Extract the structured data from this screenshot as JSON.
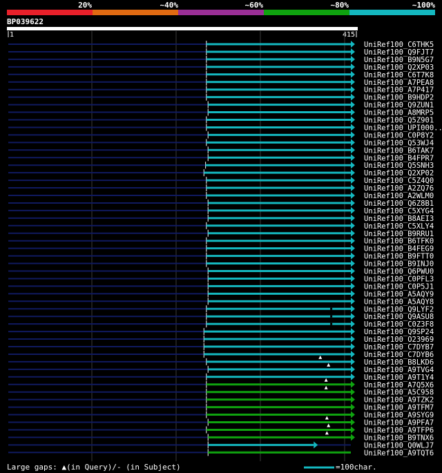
{
  "legend": {
    "labels": [
      "20%",
      "~40%",
      "~60%",
      "~80%",
      "~100%"
    ],
    "colors": [
      "#e8202a",
      "#e06a12",
      "#9a2f96",
      "#0fa30f",
      "#14b8c0"
    ]
  },
  "query": {
    "id": "BP039622",
    "start_label": "1",
    "end_label": "415",
    "length": 415
  },
  "footer": {
    "gap_text": "Large gaps: ▲(in Query)/- (in Subject)",
    "scale_text": "=100char."
  },
  "hits": [
    {
      "id": "UniRef100_C6THK5",
      "start": 240,
      "end": 415,
      "color": "cyan",
      "arrow": true
    },
    {
      "id": "UniRef100_Q9FJT7",
      "start": 240,
      "end": 415,
      "color": "cyan",
      "arrow": true
    },
    {
      "id": "UniRef100_B9N5G7",
      "start": 240,
      "end": 415,
      "color": "cyan",
      "arrow": true
    },
    {
      "id": "UniRef100_Q2XP03",
      "start": 240,
      "end": 415,
      "color": "cyan",
      "arrow": true
    },
    {
      "id": "UniRef100_C6T7K8",
      "start": 240,
      "end": 415,
      "color": "cyan",
      "arrow": true
    },
    {
      "id": "UniRef100_A7PEA8",
      "start": 240,
      "end": 415,
      "color": "cyan",
      "arrow": true
    },
    {
      "id": "UniRef100_A7P417",
      "start": 240,
      "end": 415,
      "color": "cyan",
      "arrow": true
    },
    {
      "id": "UniRef100_B9HDP2",
      "start": 240,
      "end": 415,
      "color": "cyan",
      "arrow": true
    },
    {
      "id": "UniRef100_Q9ZUN1",
      "start": 242,
      "end": 415,
      "color": "cyan",
      "arrow": true
    },
    {
      "id": "UniRef100_A8MRP5",
      "start": 242,
      "end": 415,
      "color": "cyan",
      "arrow": true
    },
    {
      "id": "UniRef100_Q5Z901",
      "start": 240,
      "end": 415,
      "color": "cyan",
      "arrow": true
    },
    {
      "id": "UniRef100_UPI000..",
      "start": 240,
      "end": 415,
      "color": "cyan",
      "arrow": true
    },
    {
      "id": "UniRef100_C0P8Y2",
      "start": 242,
      "end": 415,
      "color": "cyan",
      "arrow": true
    },
    {
      "id": "UniRef100_Q53WJ4",
      "start": 240,
      "end": 415,
      "color": "cyan",
      "arrow": true
    },
    {
      "id": "UniRef100_B6TAK7",
      "start": 242,
      "end": 415,
      "color": "cyan",
      "arrow": true
    },
    {
      "id": "UniRef100_B4FPR7",
      "start": 242,
      "end": 415,
      "color": "cyan",
      "arrow": true
    },
    {
      "id": "UniRef100_Q5SNH3",
      "start": 239,
      "end": 415,
      "color": "cyan",
      "arrow": true
    },
    {
      "id": "UniRef100_Q2XP02",
      "start": 237,
      "end": 415,
      "color": "cyan",
      "arrow": true
    },
    {
      "id": "UniRef100_C5Z4Q0",
      "start": 240,
      "end": 415,
      "color": "cyan",
      "arrow": true
    },
    {
      "id": "UniRef100_A2ZQ76",
      "start": 240,
      "end": 415,
      "color": "cyan",
      "arrow": true
    },
    {
      "id": "UniRef100_A2WLM0",
      "start": 240,
      "end": 415,
      "color": "cyan",
      "arrow": true
    },
    {
      "id": "UniRef100_Q6Z8B1",
      "start": 242,
      "end": 415,
      "color": "cyan",
      "arrow": true
    },
    {
      "id": "UniRef100_C5XYG4",
      "start": 242,
      "end": 415,
      "color": "cyan",
      "arrow": true
    },
    {
      "id": "UniRef100_B8AEI3",
      "start": 242,
      "end": 415,
      "color": "cyan",
      "arrow": true
    },
    {
      "id": "UniRef100_C5XLY4",
      "start": 240,
      "end": 415,
      "color": "cyan",
      "arrow": true
    },
    {
      "id": "UniRef100_B9RRU1",
      "start": 242,
      "end": 415,
      "color": "cyan",
      "arrow": true
    },
    {
      "id": "UniRef100_B6TFK0",
      "start": 240,
      "end": 415,
      "color": "cyan",
      "arrow": true
    },
    {
      "id": "UniRef100_B4FEG9",
      "start": 240,
      "end": 415,
      "color": "cyan",
      "arrow": true
    },
    {
      "id": "UniRef100_B9FTT0",
      "start": 240,
      "end": 415,
      "color": "cyan",
      "arrow": true
    },
    {
      "id": "UniRef100_B9INJ0",
      "start": 240,
      "end": 415,
      "color": "cyan",
      "arrow": true
    },
    {
      "id": "UniRef100_Q6PWU0",
      "start": 242,
      "end": 415,
      "color": "cyan",
      "arrow": true
    },
    {
      "id": "UniRef100_C0PFL3",
      "start": 242,
      "end": 415,
      "color": "cyan",
      "arrow": true
    },
    {
      "id": "UniRef100_C0P5J1",
      "start": 242,
      "end": 415,
      "color": "cyan",
      "arrow": true
    },
    {
      "id": "UniRef100_A5AQY9",
      "start": 242,
      "end": 415,
      "color": "cyan",
      "arrow": true
    },
    {
      "id": "UniRef100_A5AQY8",
      "start": 242,
      "end": 415,
      "color": "cyan",
      "arrow": true
    },
    {
      "id": "UniRef100_Q9LYF2",
      "start": 240,
      "end": 415,
      "color": "cyan",
      "arrow": true,
      "gaps": [
        390
      ]
    },
    {
      "id": "UniRef100_Q9ASU8",
      "start": 240,
      "end": 415,
      "color": "cyan",
      "arrow": true,
      "gaps": [
        390
      ]
    },
    {
      "id": "UniRef100_C0Z3F8",
      "start": 240,
      "end": 415,
      "color": "cyan",
      "arrow": true,
      "gaps": [
        390
      ]
    },
    {
      "id": "UniRef100_Q9SP24",
      "start": 237,
      "end": 415,
      "color": "cyan",
      "arrow": true
    },
    {
      "id": "UniRef100_O23969",
      "start": 237,
      "end": 415,
      "color": "cyan",
      "arrow": true
    },
    {
      "id": "UniRef100_C7DYB7",
      "start": 237,
      "end": 415,
      "color": "cyan",
      "arrow": true
    },
    {
      "id": "UniRef100_C7DYB6",
      "start": 237,
      "end": 415,
      "color": "cyan",
      "arrow": true
    },
    {
      "id": "UniRef100_B8LKD6",
      "start": 240,
      "end": 415,
      "color": "cyan",
      "arrow": true,
      "inserts": [
        378
      ]
    },
    {
      "id": "UniRef100_A9TVG4",
      "start": 242,
      "end": 415,
      "color": "cyan",
      "arrow": true,
      "inserts": [
        388
      ]
    },
    {
      "id": "UniRef100_A9T1Y4",
      "start": 240,
      "end": 415,
      "color": "cyan",
      "arrow": true
    },
    {
      "id": "UniRef100_A7Q5X6",
      "start": 240,
      "end": 415,
      "color": "green",
      "arrow": true,
      "inserts": [
        385
      ]
    },
    {
      "id": "UniRef100_A5C958",
      "start": 240,
      "end": 415,
      "color": "green",
      "arrow": true,
      "inserts": [
        385
      ]
    },
    {
      "id": "UniRef100_A9TZK2",
      "start": 240,
      "end": 415,
      "color": "green",
      "arrow": true
    },
    {
      "id": "UniRef100_A9TFM7",
      "start": 240,
      "end": 415,
      "color": "green",
      "arrow": true
    },
    {
      "id": "UniRef100_A9SYG9",
      "start": 240,
      "end": 415,
      "color": "green",
      "arrow": true
    },
    {
      "id": "UniRef100_A9PFA7",
      "start": 242,
      "end": 415,
      "color": "green",
      "arrow": true,
      "inserts": [
        386
      ]
    },
    {
      "id": "UniRef100_A9TFP6",
      "start": 240,
      "end": 415,
      "color": "green",
      "arrow": true,
      "inserts": [
        388
      ]
    },
    {
      "id": "UniRef100_B9TNX6",
      "start": 242,
      "end": 415,
      "color": "green",
      "arrow": true,
      "inserts": [
        386
      ]
    },
    {
      "id": "UniRef100_Q0WLJ7",
      "start": 242,
      "end": 370,
      "color": "cyan",
      "arrow": true
    },
    {
      "id": "UniRef100_A9TQT6",
      "start": 242,
      "end": 415,
      "color": "green",
      "arrow": false
    }
  ]
}
